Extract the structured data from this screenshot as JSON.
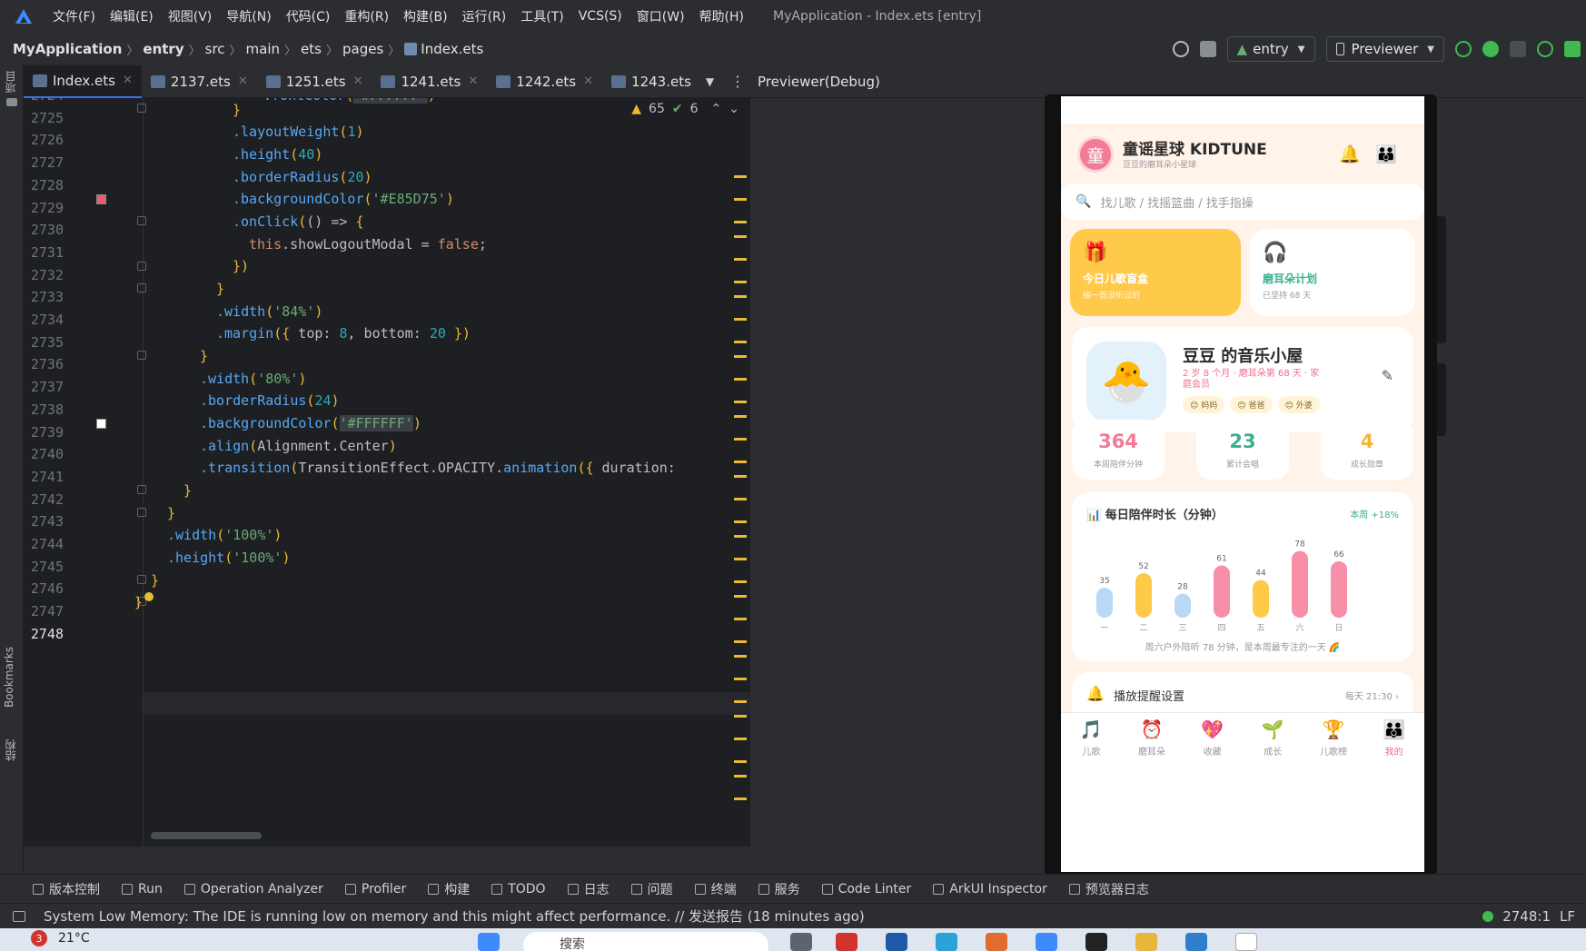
{
  "menu": [
    "文件(F)",
    "编辑(E)",
    "视图(V)",
    "导航(N)",
    "代码(C)",
    "重构(R)",
    "构建(B)",
    "运行(R)",
    "工具(T)",
    "VCS(S)",
    "窗口(W)",
    "帮助(H)"
  ],
  "window_title": "MyApplication - Index.ets [entry]",
  "breadcrumb": [
    "MyApplication",
    "entry",
    "src",
    "main",
    "ets",
    "pages",
    "Index.ets"
  ],
  "toolbar": {
    "module": "entry",
    "device": "Previewer"
  },
  "left_strip": {
    "project": "项目",
    "bookmarks": "Bookmarks",
    "structure": "结构"
  },
  "tabs": [
    "Index.ets",
    "2137.ets",
    "1251.ets",
    "1241.ets",
    "1242.ets",
    "1243.ets"
  ],
  "inspection": {
    "warnings": "65",
    "weak": "6"
  },
  "code_first_partial": ".fontColor('#FFFFFF')",
  "line_numbers": [
    "2724",
    "2725",
    "2726",
    "2727",
    "2728",
    "2729",
    "2730",
    "2731",
    "2732",
    "2733",
    "2734",
    "2735",
    "2736",
    "2737",
    "2738",
    "2739",
    "2740",
    "2741",
    "2742",
    "2743",
    "2744",
    "2745",
    "2746",
    "2747",
    "2748"
  ],
  "current_line": "2748",
  "previewer_title": "Previewer(Debug)",
  "app": {
    "avatar_char": "童",
    "name": "童谣星球 KIDTUNE",
    "subtitle": "豆豆的磨耳朵小星球",
    "bell_icon": "bell-icon",
    "search_placeholder": "找儿歌 / 找摇篮曲 / 找手指操",
    "card_blindbox": {
      "title": "今日儿歌盲盒",
      "subtitle": "抽一首没听过的"
    },
    "card_plan": {
      "title": "磨耳朵计划",
      "subtitle": "已坚持 68 天"
    },
    "profile": {
      "name": "豆豆 的音乐小屋",
      "subtitle": "2 岁 8 个月 · 磨耳朵第 68 天 · 家庭会员",
      "tags": [
        "妈妈",
        "爸爸",
        "外婆"
      ]
    },
    "stats": [
      {
        "value": "364",
        "label": "本周陪伴分钟",
        "color": "#f07c96"
      },
      {
        "value": "23",
        "label": "累计会唱",
        "color": "#3bb08f"
      },
      {
        "value": "4",
        "label": "成长勋章",
        "color": "#f5b53b"
      }
    ],
    "reminder": {
      "title": "播放提醒设置",
      "time": "每天 21:30"
    },
    "nav": [
      {
        "label": "儿歌",
        "icon": "music-note-icon"
      },
      {
        "label": "磨耳朵",
        "icon": "alarm-clock-icon"
      },
      {
        "label": "收藏",
        "icon": "heart-icon"
      },
      {
        "label": "成长",
        "icon": "sprout-icon"
      },
      {
        "label": "儿歌榜",
        "icon": "trophy-icon"
      },
      {
        "label": "我的",
        "icon": "family-icon"
      }
    ]
  },
  "chart_data": {
    "type": "bar",
    "title": "每日陪伴时长（分钟）",
    "badge": "本周 +18%",
    "categories": [
      "一",
      "二",
      "三",
      "四",
      "五",
      "六",
      "日"
    ],
    "values": [
      35,
      52,
      28,
      61,
      44,
      78,
      66
    ],
    "colors": [
      "#b8d8f5",
      "#ffc94a",
      "#b8d8f5",
      "#f78fa8",
      "#ffc94a",
      "#f78fa8",
      "#f78fa8"
    ],
    "ylim": [
      0,
      85
    ],
    "footer": "周六户外陪听 78 分钟，是本周最专注的一天 🌈"
  },
  "toolwindows": [
    "版本控制",
    "Run",
    "Operation Analyzer",
    "Profiler",
    "构建",
    "TODO",
    "日志",
    "问题",
    "终端",
    "服务",
    "Code Linter",
    "ArkUI Inspector",
    "预览器日志"
  ],
  "status": {
    "message": "System Low Memory: The IDE is running low on memory and this might affect performance. // 发送报告 (18 minutes ago)",
    "position": "2748:1",
    "line_sep": "LF"
  },
  "taskbar": {
    "badge": "3",
    "temp": "21°C",
    "search": "搜索"
  }
}
